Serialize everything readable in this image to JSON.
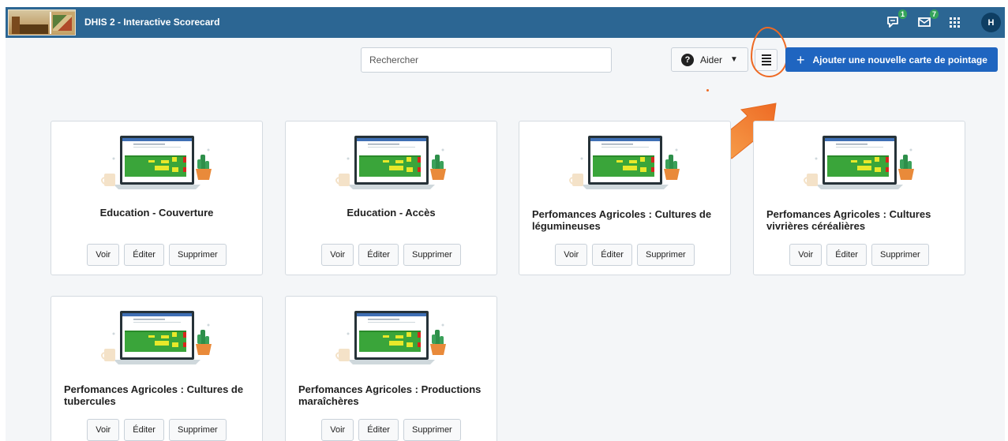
{
  "header": {
    "app_title": "DHIS 2 - Interactive Scorecard",
    "messages_badge": "1",
    "interpretations_badge": "7",
    "avatar_initial": "H",
    "color": "#2c6693"
  },
  "toolbar": {
    "search_placeholder": "Rechercher",
    "help_label": "Aider",
    "add_label": "Ajouter une nouvelle carte de pointage",
    "add_color": "#1f65c0"
  },
  "annotation": {
    "color": "#ee6a24"
  },
  "cards": [
    {
      "title": "Education - Couverture",
      "view": "Voir",
      "edit": "Éditer",
      "delete": "Supprimer"
    },
    {
      "title": "Education - Accès",
      "view": "Voir",
      "edit": "Éditer",
      "delete": "Supprimer"
    },
    {
      "title": "Perfomances Agricoles : Cultures de légumineuses",
      "view": "Voir",
      "edit": "Éditer",
      "delete": "Supprimer"
    },
    {
      "title": "Perfomances Agricoles : Cultures vivrières céréalières",
      "view": "Voir",
      "edit": "Éditer",
      "delete": "Supprimer"
    },
    {
      "title": "Perfomances Agricoles : Cultures de tubercules",
      "view": "Voir",
      "edit": "Éditer",
      "delete": "Supprimer"
    },
    {
      "title": "Perfomances Agricoles : Productions maraîchères",
      "view": "Voir",
      "edit": "Éditer",
      "delete": "Supprimer"
    }
  ]
}
